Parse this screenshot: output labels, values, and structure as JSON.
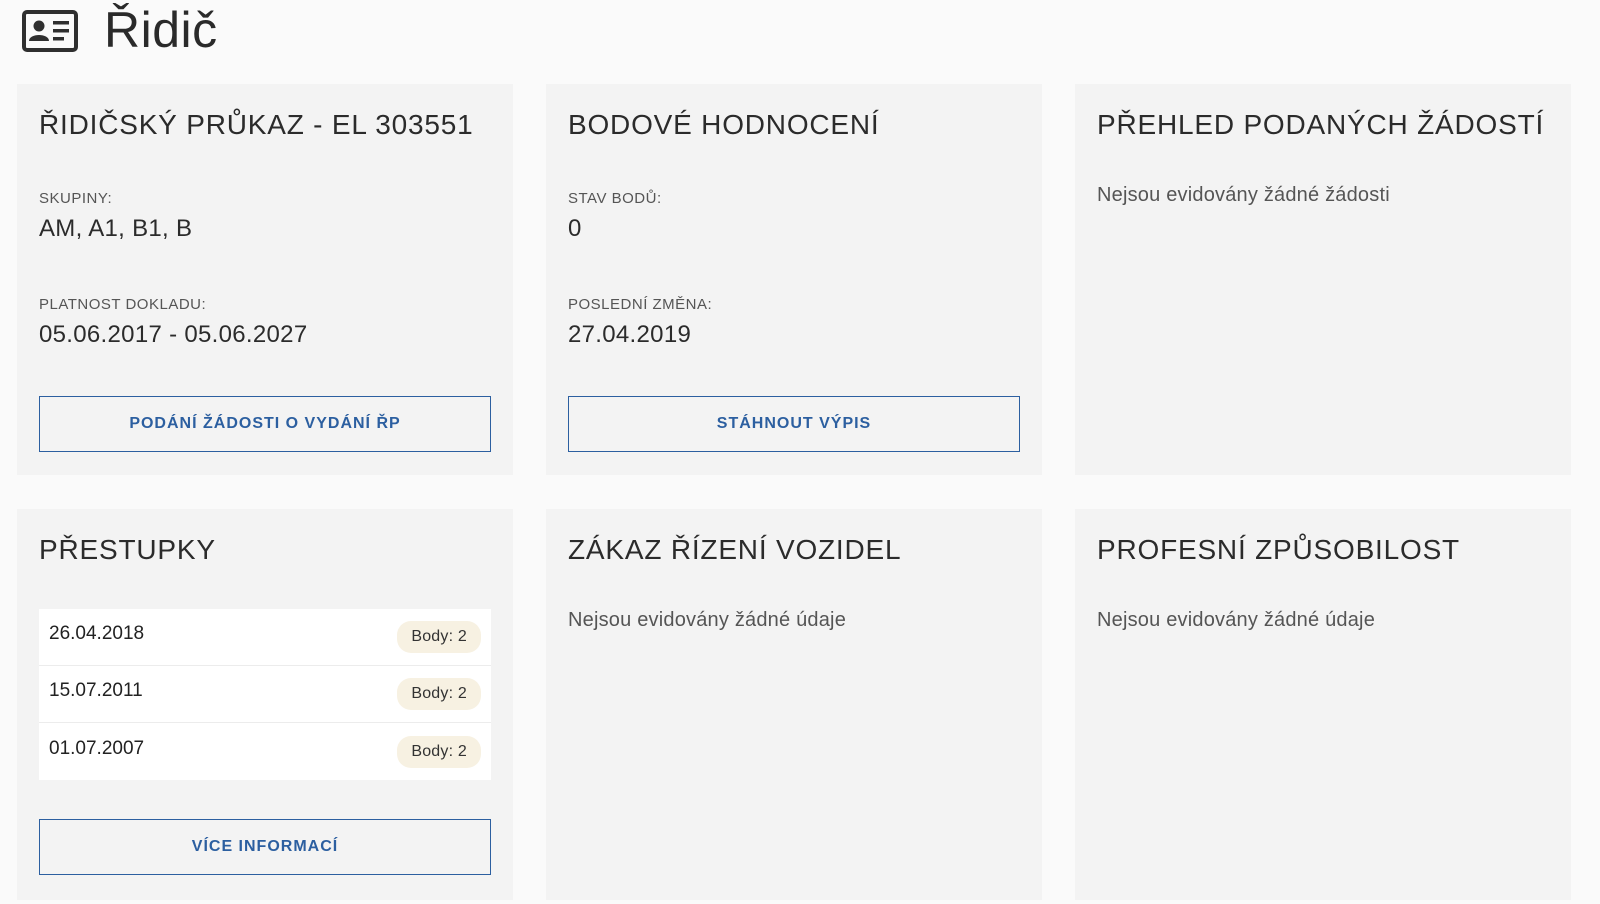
{
  "header": {
    "icon": "id-card-icon",
    "title": "Řidič"
  },
  "license": {
    "title": "ŘIDIČSKÝ PRŮKAZ - EL 303551",
    "groups_label": "SKUPINY:",
    "groups_value": "AM, A1, B1, B",
    "validity_label": "PLATNOST DOKLADU:",
    "validity_value": "05.06.2017 - 05.06.2027",
    "button": "PODÁNÍ ŽÁDOSTI O VYDÁNÍ ŘP"
  },
  "points": {
    "title": "BODOVÉ HODNOCENÍ",
    "status_label": "STAV BODŮ:",
    "status_value": "0",
    "last_change_label": "POSLEDNÍ ZMĚNA:",
    "last_change_value": "27.04.2019",
    "button": "STÁHNOUT VÝPIS"
  },
  "requests": {
    "title": "PŘEHLED PODANÝCH ŽÁDOSTÍ",
    "empty": "Nejsou evidovány žádné žádosti"
  },
  "offenses": {
    "title": "PŘESTUPKY",
    "items": [
      {
        "date": "26.04.2018",
        "badge": "Body: 2"
      },
      {
        "date": "15.07.2011",
        "badge": "Body: 2"
      },
      {
        "date": "01.07.2007",
        "badge": "Body: 2"
      }
    ],
    "button": "VÍCE INFORMACÍ"
  },
  "ban": {
    "title": "ZÁKAZ ŘÍZENÍ VOZIDEL",
    "empty": "Nejsou evidovány žádné údaje"
  },
  "professional": {
    "title": "PROFESNÍ ZPŮSOBILOST",
    "empty": "Nejsou evidovány žádné údaje"
  },
  "colors": {
    "accent": "#2c5fa0",
    "card_bg": "#f3f3f3",
    "page_bg": "#fafafa",
    "badge_bg": "#f7f1e2"
  }
}
